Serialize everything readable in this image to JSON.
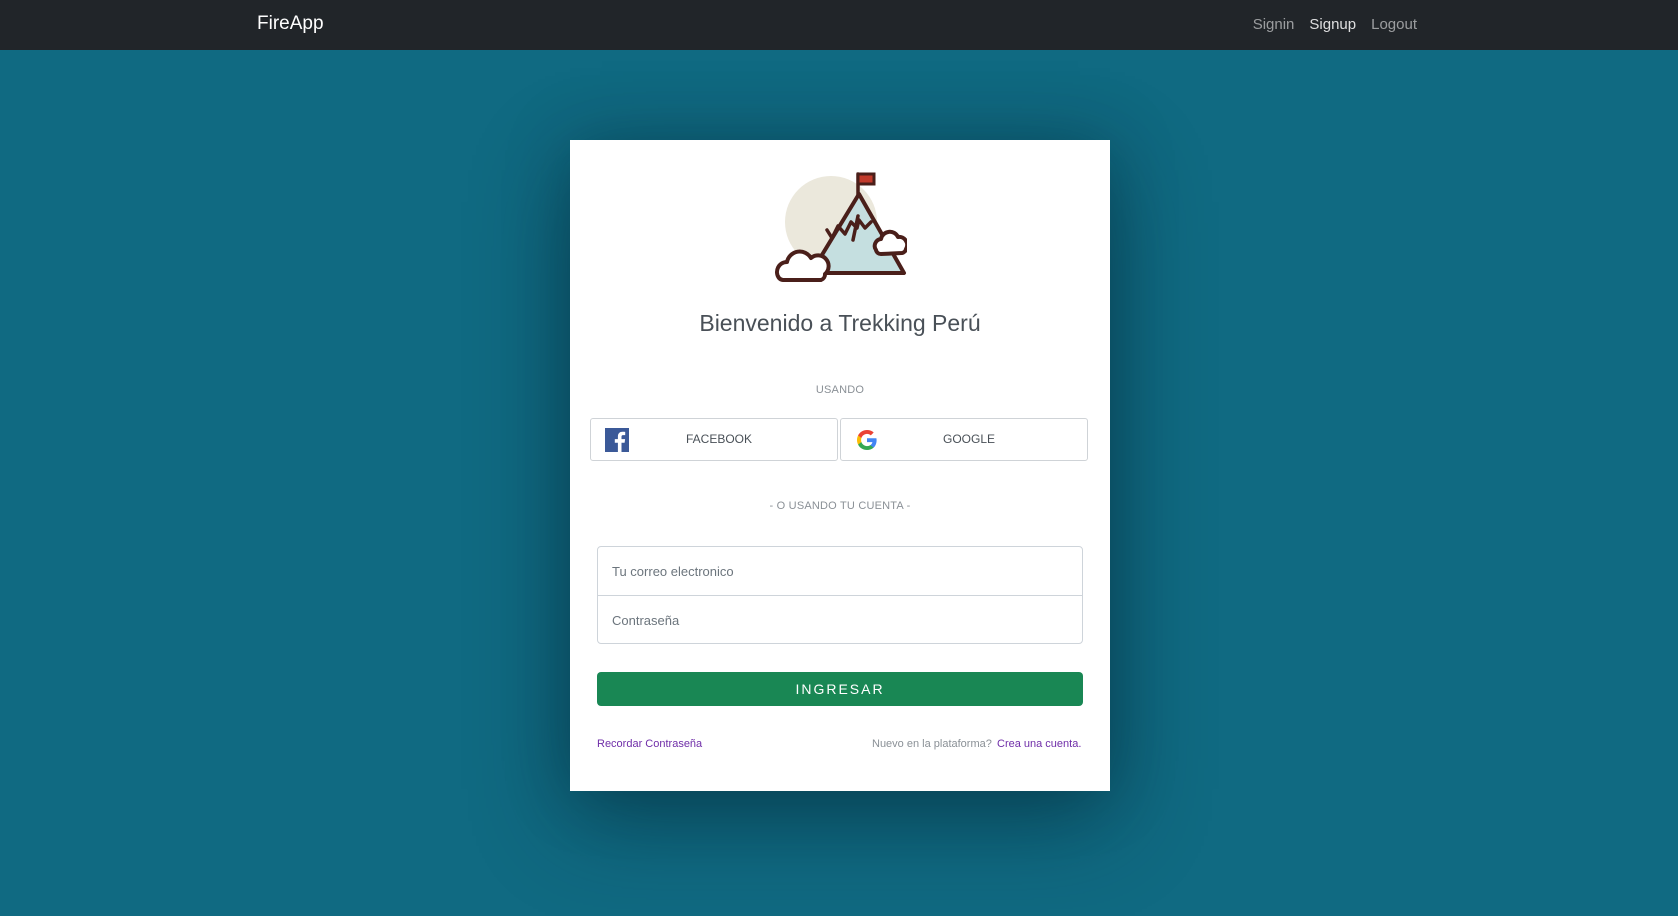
{
  "navbar": {
    "brand": "FireApp",
    "links": [
      {
        "label": "Signin",
        "active": false
      },
      {
        "label": "Signup",
        "active": true
      },
      {
        "label": "Logout",
        "active": false
      }
    ]
  },
  "card": {
    "logo_icon": "mountain-flag-icon",
    "title": "Bienvenido a Trekking Perú",
    "using_label": "USANDO",
    "social": {
      "facebook_label": "FACEBOOK",
      "facebook_icon": "facebook-icon",
      "google_label": "GOOGLE",
      "google_icon": "google-icon"
    },
    "or_label": "- O USANDO TU CUENTA -",
    "form": {
      "email_placeholder": "Tu correo electronico",
      "password_placeholder": "Contraseña",
      "submit_label": "INGRESAR"
    },
    "footer": {
      "forgot_label": "Recordar Contraseña",
      "new_user_text": "Nuevo en la plataforma?",
      "create_account_label": "Crea una cuenta."
    }
  },
  "colors": {
    "background": "#106a82",
    "navbar": "#212529",
    "primary_button": "#198754",
    "link": "#6f2da8"
  }
}
